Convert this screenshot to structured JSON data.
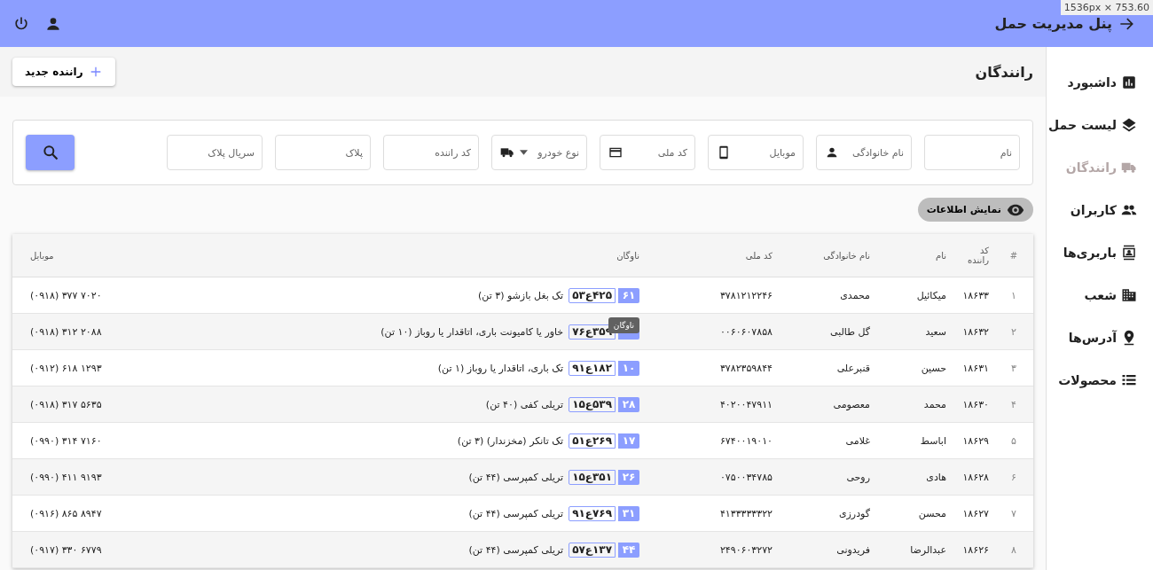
{
  "viewport_label": "1536px × 753.60",
  "header": {
    "title": "پنل مدیریت حمل"
  },
  "sidebar": {
    "items": [
      {
        "label": "داشبورد",
        "selected": false
      },
      {
        "label": "لیست حمل",
        "selected": false
      },
      {
        "label": "رانندگان",
        "selected": true
      },
      {
        "label": "کاربران",
        "selected": false
      },
      {
        "label": "باربری‌ها",
        "selected": false
      },
      {
        "label": "شعب",
        "selected": false
      },
      {
        "label": "آدرس‌ها",
        "selected": false
      },
      {
        "label": "محصولات",
        "selected": false
      }
    ]
  },
  "page": {
    "title": "رانندگان",
    "new_button": "راننده جدید"
  },
  "filters": [
    {
      "kind": "text",
      "placeholder": "نام"
    },
    {
      "kind": "icon",
      "placeholder": "نام خانوادگی"
    },
    {
      "kind": "icon",
      "placeholder": "موبایل"
    },
    {
      "kind": "icon",
      "placeholder": "کد ملی"
    },
    {
      "kind": "select",
      "placeholder": "نوع خودرو"
    },
    {
      "kind": "text",
      "placeholder": "کد راننده"
    },
    {
      "kind": "text",
      "placeholder": "پلاک"
    },
    {
      "kind": "text",
      "placeholder": "سریال پلاک"
    }
  ],
  "show_info_button": "نمایش اطلاعات",
  "table": {
    "columns": [
      "#",
      "کد راننده",
      "نام",
      "نام خانوادگی",
      "کد ملی",
      "ناوگان",
      "موبایل"
    ],
    "rows": [
      {
        "index": "۱",
        "code": "۱۸۶۳۳",
        "name": "میکائیل",
        "family": "محمدی",
        "national_code": "۳۷۸۱۲۱۲۲۴۶",
        "plate_region": "۶۱",
        "plate": "۵۳ع۴۲۵",
        "vehicle": "تک بغل بازشو (۳ تن)",
        "mobile": "(۰۹۱۸) ۳۷۷ ۷۰۲۰"
      },
      {
        "index": "۲",
        "code": "۱۸۶۳۲",
        "name": "سعید",
        "family": "گل طالبی",
        "national_code": "۰۰۶۰۶۰۷۸۵۸",
        "tooltip": "ناوگان",
        "plate": "۷۶ع۳۵۹",
        "vehicle": "خاور یا کامیونت باری، اتاقدار یا روباز (۱۰ تن)",
        "mobile": "(۰۹۱۸) ۳۱۲ ۲۰۸۸"
      },
      {
        "index": "۳",
        "code": "۱۸۶۳۱",
        "name": "حسین",
        "family": "قنبرعلی",
        "national_code": "۳۷۸۲۳۵۹۸۴۴",
        "plate_region": "۱۰",
        "plate": "۹۱ع۱۸۲",
        "vehicle": "تک باری، اتاقدار یا روباز (۱ تن)",
        "mobile": "(۰۹۱۲) ۶۱۸ ۱۲۹۳"
      },
      {
        "index": "۴",
        "code": "۱۸۶۳۰",
        "name": "محمد",
        "family": "معصومی",
        "national_code": "۴۰۲۰۰۴۷۹۱۱",
        "plate_region": "۲۸",
        "plate": "۱۵ع۵۳۹",
        "vehicle": "تریلی کفی (۴۰ تن)",
        "mobile": "(۰۹۱۸) ۳۱۷ ۵۶۳۵"
      },
      {
        "index": "۵",
        "code": "۱۸۶۲۹",
        "name": "اباسط",
        "family": "غلامی",
        "national_code": "۶۷۴۰۰۱۹۰۱۰",
        "plate_region": "۱۷",
        "plate": "۵۱ع۲۶۹",
        "vehicle": "تک تانکر (مخزندار) (۳ تن)",
        "mobile": "(۰۹۹۰) ۳۱۴ ۷۱۶۰"
      },
      {
        "index": "۶",
        "code": "۱۸۶۲۸",
        "name": "هادی",
        "family": "روحی",
        "national_code": "۰۷۵۰۰۳۴۷۸۵",
        "plate_region": "۲۶",
        "plate": "۱۵ع۳۵۱",
        "vehicle": "تریلی کمپرسی (۴۴ تن)",
        "mobile": "(۰۹۹۰) ۴۱۱ ۹۱۹۳"
      },
      {
        "index": "۷",
        "code": "۱۸۶۲۷",
        "name": "محسن",
        "family": "گودرزی",
        "national_code": "۴۱۳۳۳۳۳۳۲۲",
        "plate_region": "۳۱",
        "plate": "۹۱ع۷۶۹",
        "vehicle": "تریلی کمپرسی (۴۴ تن)",
        "mobile": "(۰۹۱۶) ۸۶۵ ۸۹۴۷"
      },
      {
        "index": "۸",
        "code": "۱۸۶۲۶",
        "name": "عبدالرضا",
        "family": "فریدونی",
        "national_code": "۲۴۹۰۶۰۳۲۷۲",
        "plate_region": "۴۴",
        "plate": "۵۷ع۱۳۷",
        "vehicle": "تریلی کمپرسی (۴۴ تن)",
        "mobile": "(۰۹۱۷) ۳۳۰ ۶۷۷۹"
      }
    ]
  }
}
